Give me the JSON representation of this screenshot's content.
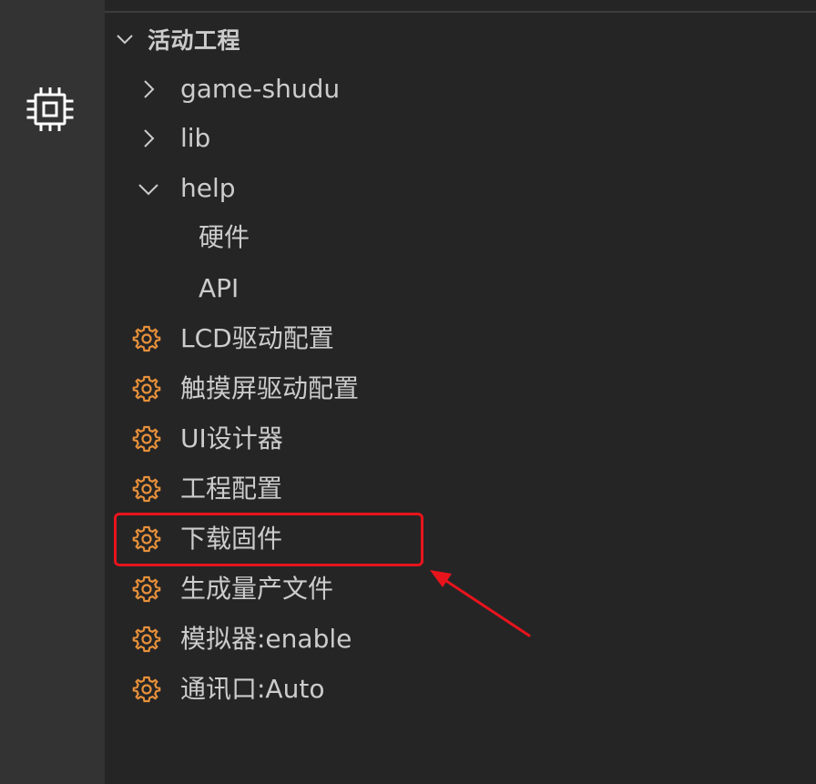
{
  "activity_bar": {
    "icon": "chip-icon"
  },
  "explorer": {
    "section_title": "活动工程",
    "section_expanded": true,
    "items": [
      {
        "label": "game-shudu",
        "type": "folder",
        "expanded": false,
        "icon": "chevron-right-icon"
      },
      {
        "label": "lib",
        "type": "folder",
        "expanded": false,
        "icon": "chevron-right-icon"
      },
      {
        "label": "help",
        "type": "folder",
        "expanded": true,
        "icon": "chevron-down-icon"
      },
      {
        "label": "硬件",
        "type": "child"
      },
      {
        "label": "API",
        "type": "child"
      },
      {
        "label": "LCD驱动配置",
        "type": "action",
        "icon": "gear-icon"
      },
      {
        "label": "触摸屏驱动配置",
        "type": "action",
        "icon": "gear-icon"
      },
      {
        "label": "UI设计器",
        "type": "action",
        "icon": "gear-icon"
      },
      {
        "label": "工程配置",
        "type": "action",
        "icon": "gear-icon"
      },
      {
        "label": "下载固件",
        "type": "action",
        "icon": "gear-icon",
        "highlighted": true
      },
      {
        "label": "生成量产文件",
        "type": "action",
        "icon": "gear-icon"
      },
      {
        "label": "模拟器:enable",
        "type": "action",
        "icon": "gear-icon"
      },
      {
        "label": "通讯口:Auto",
        "type": "action",
        "icon": "gear-icon"
      }
    ]
  },
  "colors": {
    "background": "#252526",
    "activity_bar": "#333333",
    "text": "#cccccc",
    "gear": "#e8913a",
    "annotation": "#e8141c"
  }
}
